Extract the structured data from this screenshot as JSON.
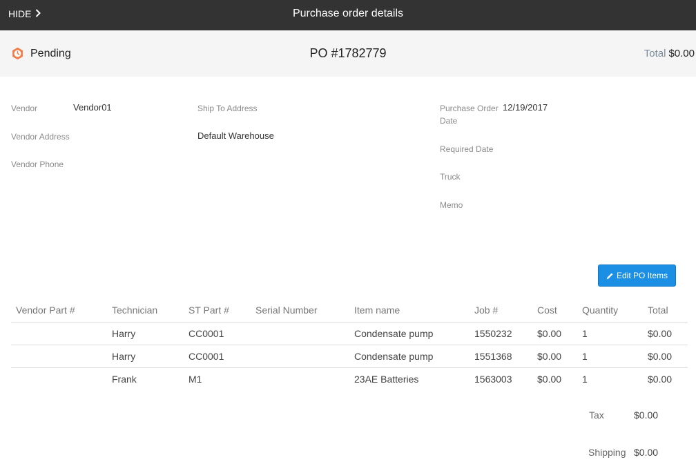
{
  "header": {
    "hide_label": "HIDE",
    "title": "Purchase order details"
  },
  "status_bar": {
    "status": "Pending",
    "po_number": "PO #1782779",
    "total_label": "Total",
    "total_value": "$0.00",
    "status_color": "#f07d4a"
  },
  "details": {
    "vendor_label": "Vendor",
    "vendor_value": "Vendor01",
    "vendor_address_label": "Vendor Address",
    "vendor_phone_label": "Vendor Phone",
    "ship_to_label": "Ship To Address",
    "ship_to_value": "Default Warehouse",
    "po_date_label_line1": "Purchase Order",
    "po_date_label_line2": "Date",
    "po_date_value": "12/19/2017",
    "required_date_label": "Required Date",
    "truck_label": "Truck",
    "memo_label": "Memo"
  },
  "edit_button": {
    "label": "Edit PO Items",
    "color": "#1a8fe3"
  },
  "table": {
    "columns": [
      "Vendor Part #",
      "Technician",
      "ST Part #",
      "Serial Number",
      "Item name",
      "Job #",
      "Cost",
      "Quantity",
      "Total"
    ],
    "rows": [
      [
        "",
        "Harry",
        "CC0001",
        "",
        "Condensate pump",
        "1550232",
        "$0.00",
        "1",
        "$0.00"
      ],
      [
        "",
        "Harry",
        "CC0001",
        "",
        "Condensate pump",
        "1551368",
        "$0.00",
        "1",
        "$0.00"
      ],
      [
        "",
        "Frank",
        "M1",
        "",
        "23AE Batteries",
        "1563003",
        "$0.00",
        "1",
        "$0.00"
      ]
    ]
  },
  "summary": {
    "tax_label": "Tax",
    "tax_value": "$0.00",
    "shipping_label": "Shipping",
    "shipping_value": "$0.00"
  }
}
